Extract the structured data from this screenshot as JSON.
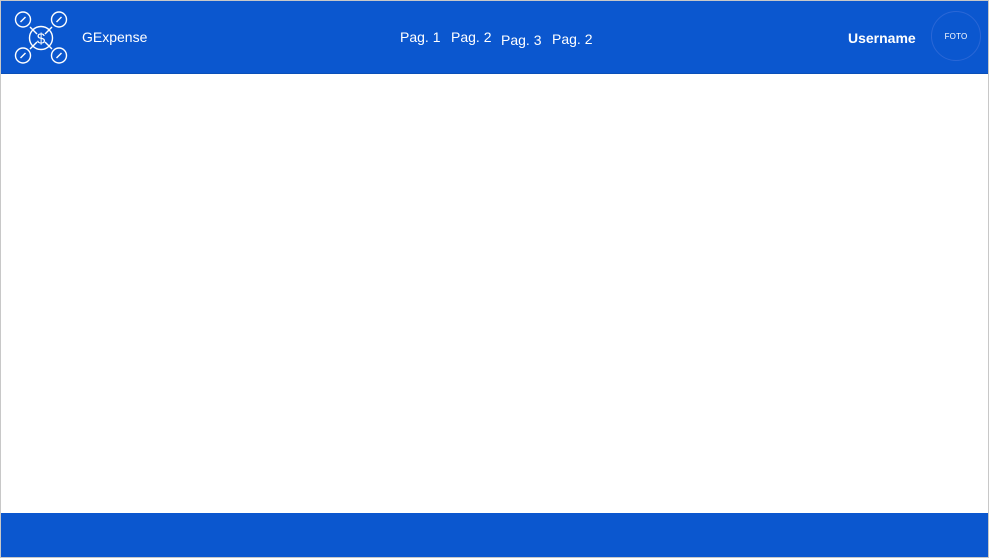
{
  "colors": {
    "brand_blue": "#0b57cf",
    "text_on_brand": "#ffffff",
    "page_background": "#ffffff"
  },
  "header": {
    "logo_icon": "money-network-icon",
    "brand_name": "GExpense",
    "nav": [
      {
        "label": "Pag. 1"
      },
      {
        "label": "Pag. 2"
      },
      {
        "label": "Pag. 3"
      },
      {
        "label": "Pag. 2"
      }
    ],
    "username": "Username",
    "avatar_label": "FOTO"
  }
}
